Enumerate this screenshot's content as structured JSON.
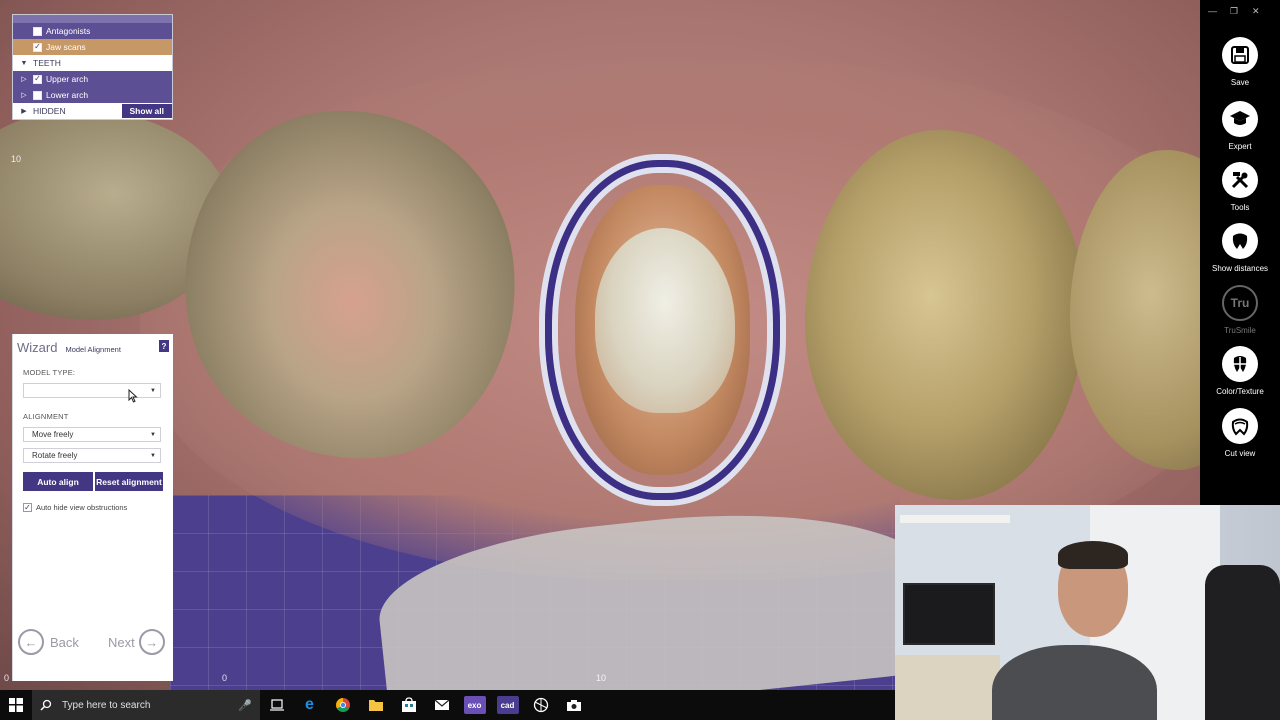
{
  "tree": {
    "items": [
      {
        "label": "Antagonists",
        "checked": false
      },
      {
        "label": "Jaw scans",
        "checked": true
      }
    ],
    "teeth_header": "TEETH",
    "teeth_items": [
      {
        "label": "Upper arch",
        "checked": true
      },
      {
        "label": "Lower arch",
        "checked": false
      }
    ],
    "hidden_label": "HIDDEN",
    "show_all": "Show all"
  },
  "wizard": {
    "title": "Wizard",
    "subtitle": "Model Alignment",
    "help": "?",
    "model_type_label": "MODEL TYPE:",
    "model_type_value": "",
    "alignment_label": "ALIGNMENT",
    "move_value": "Move freely",
    "rotate_value": "Rotate freely",
    "auto_align": "Auto align",
    "reset_alignment": "Reset alignment",
    "auto_hide_label": "Auto hide view obstructions",
    "auto_hide_checked": true,
    "back": "Back",
    "next": "Next"
  },
  "viewport": {
    "axis_labels": [
      "10",
      "0",
      "0",
      "10"
    ]
  },
  "toolbar": {
    "tools": [
      {
        "label": "Save",
        "icon": "save-icon",
        "enabled": true
      },
      {
        "label": "Expert",
        "icon": "graduation-cap-icon",
        "enabled": true
      },
      {
        "label": "Tools",
        "icon": "wrench-hammer-icon",
        "enabled": true
      },
      {
        "label": "Show distances",
        "icon": "tooth-distance-icon",
        "enabled": true
      },
      {
        "label": "TruSmile",
        "icon": "trusmile-icon",
        "enabled": false
      },
      {
        "label": "Color/Texture",
        "icon": "color-texture-icon",
        "enabled": true
      },
      {
        "label": "Cut view",
        "icon": "tooth-cut-icon",
        "enabled": true
      }
    ],
    "trusmile_glyph": "Tru"
  },
  "taskbar": {
    "search_placeholder": "Type here to search",
    "apps": [
      "task-view",
      "edge",
      "chrome",
      "file-explorer",
      "store",
      "mail",
      "exo",
      "cad",
      "app-circle",
      "camera"
    ],
    "exo_label": "exo",
    "cad_label": "cad"
  },
  "colors": {
    "accent": "#433683",
    "panel_row": "#5c4f94",
    "jaw_scans_row": "#c69865",
    "margin_line": "#3c2f86"
  }
}
